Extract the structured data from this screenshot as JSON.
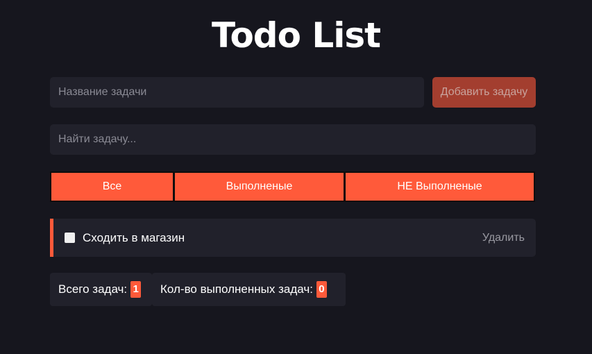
{
  "app": {
    "title": "Todo List"
  },
  "new_task": {
    "placeholder": "Название задачи",
    "add_label": "Добавить задачу"
  },
  "search": {
    "placeholder": "Найти задачу..."
  },
  "filters": [
    {
      "label": "Все"
    },
    {
      "label": "Выполненые"
    },
    {
      "label": "НЕ Выполненые"
    }
  ],
  "todos": [
    {
      "text": "Сходить в магазин",
      "done": false,
      "delete_label": "Удалить"
    }
  ],
  "stats": {
    "total_label": "Всего задач:",
    "total_count": "1",
    "done_label": "Кол-во выполненных задач:",
    "done_count": "0"
  },
  "colors": {
    "background": "#16161e",
    "surface": "#21212b",
    "accent": "#ff5a3a",
    "accent_dim": "#a33e2f"
  }
}
